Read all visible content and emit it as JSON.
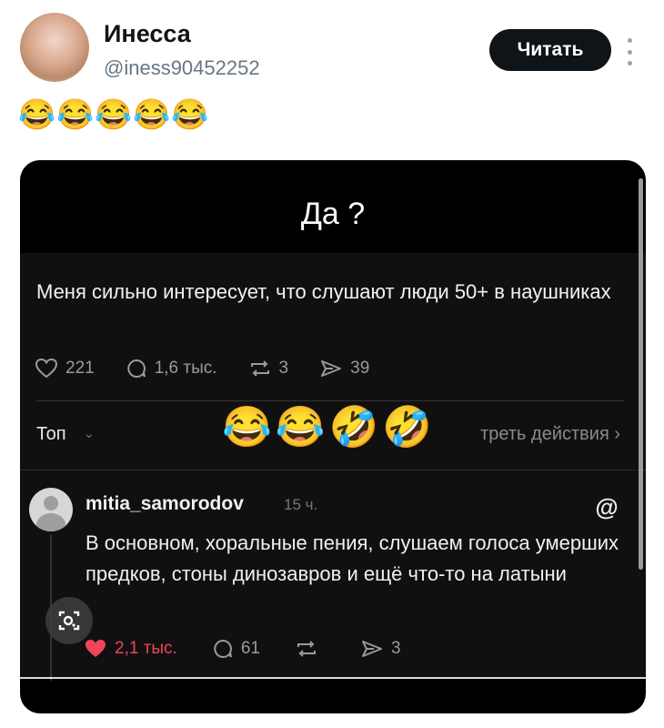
{
  "author": {
    "display_name": "Инесса",
    "handle": "@iness90452252"
  },
  "follow_label": "Читать",
  "tweet_text": "😂😂😂😂😂",
  "media": {
    "caption": "Да ?",
    "post": {
      "text": "Меня сильно интересует, что слушают люди 50+ в наушниках",
      "likes": "221",
      "replies": "1,6 тыс.",
      "reposts": "3",
      "shares": "39"
    },
    "filter": {
      "sort_label": "Топ",
      "view_activity_label": "треть действия"
    },
    "overlay_emojis": "😂😂🤣🤣",
    "reply": {
      "username": "mitia_samorodov",
      "time": "15 ч.",
      "text": "В основном, хоральные пения, слушаем голоса умерших предков, стоны динозавров и ещё что-то на латыни",
      "likes": "2,1 тыс.",
      "replies": "61",
      "shares": "3"
    }
  },
  "colors": {
    "like_red": "#f0445a",
    "button_dark": "#0f1419",
    "handle_gray": "#687684"
  }
}
